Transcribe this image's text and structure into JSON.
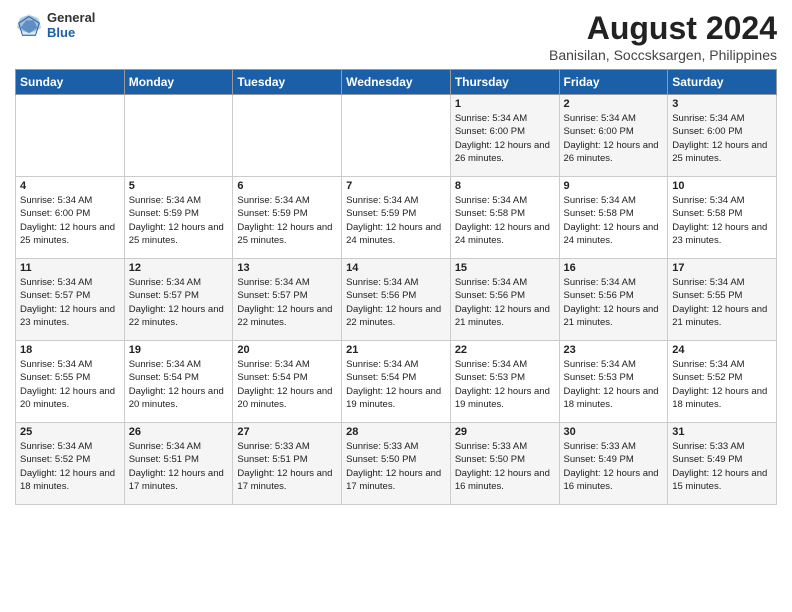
{
  "header": {
    "logo_general": "General",
    "logo_blue": "Blue",
    "main_title": "August 2024",
    "subtitle": "Banisilan, Soccsksargen, Philippines"
  },
  "days_of_week": [
    "Sunday",
    "Monday",
    "Tuesday",
    "Wednesday",
    "Thursday",
    "Friday",
    "Saturday"
  ],
  "weeks": [
    {
      "days": [
        {
          "num": "",
          "detail": ""
        },
        {
          "num": "",
          "detail": ""
        },
        {
          "num": "",
          "detail": ""
        },
        {
          "num": "",
          "detail": ""
        },
        {
          "num": "1",
          "detail": "Sunrise: 5:34 AM\nSunset: 6:00 PM\nDaylight: 12 hours\nand 26 minutes."
        },
        {
          "num": "2",
          "detail": "Sunrise: 5:34 AM\nSunset: 6:00 PM\nDaylight: 12 hours\nand 26 minutes."
        },
        {
          "num": "3",
          "detail": "Sunrise: 5:34 AM\nSunset: 6:00 PM\nDaylight: 12 hours\nand 25 minutes."
        }
      ]
    },
    {
      "days": [
        {
          "num": "4",
          "detail": "Sunrise: 5:34 AM\nSunset: 6:00 PM\nDaylight: 12 hours\nand 25 minutes."
        },
        {
          "num": "5",
          "detail": "Sunrise: 5:34 AM\nSunset: 5:59 PM\nDaylight: 12 hours\nand 25 minutes."
        },
        {
          "num": "6",
          "detail": "Sunrise: 5:34 AM\nSunset: 5:59 PM\nDaylight: 12 hours\nand 25 minutes."
        },
        {
          "num": "7",
          "detail": "Sunrise: 5:34 AM\nSunset: 5:59 PM\nDaylight: 12 hours\nand 24 minutes."
        },
        {
          "num": "8",
          "detail": "Sunrise: 5:34 AM\nSunset: 5:58 PM\nDaylight: 12 hours\nand 24 minutes."
        },
        {
          "num": "9",
          "detail": "Sunrise: 5:34 AM\nSunset: 5:58 PM\nDaylight: 12 hours\nand 24 minutes."
        },
        {
          "num": "10",
          "detail": "Sunrise: 5:34 AM\nSunset: 5:58 PM\nDaylight: 12 hours\nand 23 minutes."
        }
      ]
    },
    {
      "days": [
        {
          "num": "11",
          "detail": "Sunrise: 5:34 AM\nSunset: 5:57 PM\nDaylight: 12 hours\nand 23 minutes."
        },
        {
          "num": "12",
          "detail": "Sunrise: 5:34 AM\nSunset: 5:57 PM\nDaylight: 12 hours\nand 22 minutes."
        },
        {
          "num": "13",
          "detail": "Sunrise: 5:34 AM\nSunset: 5:57 PM\nDaylight: 12 hours\nand 22 minutes."
        },
        {
          "num": "14",
          "detail": "Sunrise: 5:34 AM\nSunset: 5:56 PM\nDaylight: 12 hours\nand 22 minutes."
        },
        {
          "num": "15",
          "detail": "Sunrise: 5:34 AM\nSunset: 5:56 PM\nDaylight: 12 hours\nand 21 minutes."
        },
        {
          "num": "16",
          "detail": "Sunrise: 5:34 AM\nSunset: 5:56 PM\nDaylight: 12 hours\nand 21 minutes."
        },
        {
          "num": "17",
          "detail": "Sunrise: 5:34 AM\nSunset: 5:55 PM\nDaylight: 12 hours\nand 21 minutes."
        }
      ]
    },
    {
      "days": [
        {
          "num": "18",
          "detail": "Sunrise: 5:34 AM\nSunset: 5:55 PM\nDaylight: 12 hours\nand 20 minutes."
        },
        {
          "num": "19",
          "detail": "Sunrise: 5:34 AM\nSunset: 5:54 PM\nDaylight: 12 hours\nand 20 minutes."
        },
        {
          "num": "20",
          "detail": "Sunrise: 5:34 AM\nSunset: 5:54 PM\nDaylight: 12 hours\nand 20 minutes."
        },
        {
          "num": "21",
          "detail": "Sunrise: 5:34 AM\nSunset: 5:54 PM\nDaylight: 12 hours\nand 19 minutes."
        },
        {
          "num": "22",
          "detail": "Sunrise: 5:34 AM\nSunset: 5:53 PM\nDaylight: 12 hours\nand 19 minutes."
        },
        {
          "num": "23",
          "detail": "Sunrise: 5:34 AM\nSunset: 5:53 PM\nDaylight: 12 hours\nand 18 minutes."
        },
        {
          "num": "24",
          "detail": "Sunrise: 5:34 AM\nSunset: 5:52 PM\nDaylight: 12 hours\nand 18 minutes."
        }
      ]
    },
    {
      "days": [
        {
          "num": "25",
          "detail": "Sunrise: 5:34 AM\nSunset: 5:52 PM\nDaylight: 12 hours\nand 18 minutes."
        },
        {
          "num": "26",
          "detail": "Sunrise: 5:34 AM\nSunset: 5:51 PM\nDaylight: 12 hours\nand 17 minutes."
        },
        {
          "num": "27",
          "detail": "Sunrise: 5:33 AM\nSunset: 5:51 PM\nDaylight: 12 hours\nand 17 minutes."
        },
        {
          "num": "28",
          "detail": "Sunrise: 5:33 AM\nSunset: 5:50 PM\nDaylight: 12 hours\nand 17 minutes."
        },
        {
          "num": "29",
          "detail": "Sunrise: 5:33 AM\nSunset: 5:50 PM\nDaylight: 12 hours\nand 16 minutes."
        },
        {
          "num": "30",
          "detail": "Sunrise: 5:33 AM\nSunset: 5:49 PM\nDaylight: 12 hours\nand 16 minutes."
        },
        {
          "num": "31",
          "detail": "Sunrise: 5:33 AM\nSunset: 5:49 PM\nDaylight: 12 hours\nand 15 minutes."
        }
      ]
    }
  ]
}
